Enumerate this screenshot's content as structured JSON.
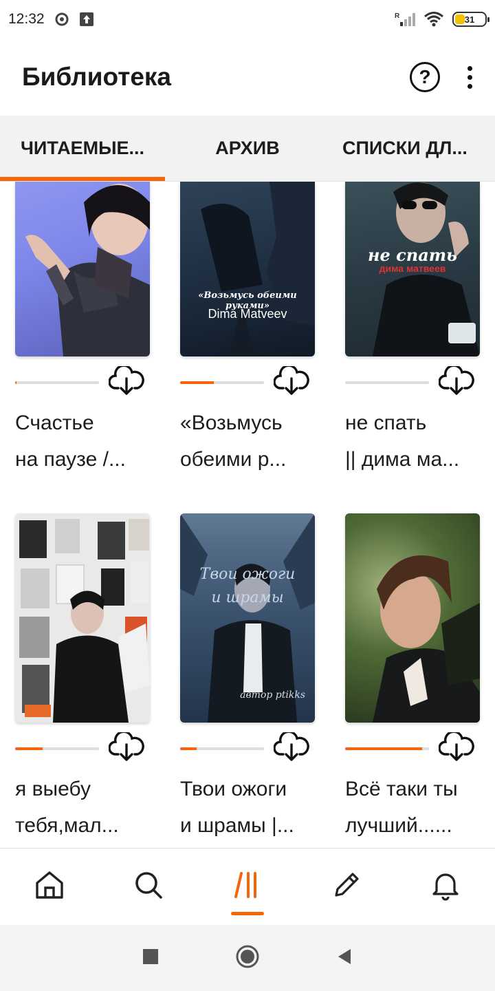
{
  "status_bar": {
    "time": "12:32",
    "battery": "31"
  },
  "app_bar": {
    "title": "Библиотека",
    "help_label": "?"
  },
  "tabs": [
    {
      "label": "ЧИТАЕМЫЕ..."
    },
    {
      "label": "АРХИВ"
    },
    {
      "label": "СПИСКИ ДЛ..."
    }
  ],
  "books": [
    {
      "title_line1": "Счастье",
      "title_line2": "на паузе /...",
      "progress": 0.02
    },
    {
      "title_line1": "«Возьмусь",
      "title_line2": "обеими р...",
      "progress": 0.4,
      "cover_text_1": "«Возьмусь обеими руками»",
      "cover_text_2": "Dima Matveev"
    },
    {
      "title_line1": "не спать",
      "title_line2": "|| дима ма...",
      "progress": 0.0,
      "cover_text_1": "не спать",
      "cover_text_2": "дима матвеев"
    },
    {
      "title_line1": "я выебу",
      "title_line2": "тебя,мал...",
      "progress": 0.33
    },
    {
      "title_line1": "Твои ожоги",
      "title_line2": "и шрамы |...",
      "progress": 0.2,
      "cover_text_1": "Твои ожоги",
      "cover_text_2": "и шрамы",
      "cover_text_3": "автор ptikks"
    },
    {
      "title_line1": "Всё таки ты",
      "title_line2": "лучший......",
      "progress": 0.92
    }
  ],
  "colors": {
    "accent": "#f5650a",
    "tab_bg": "#f3f2f3"
  },
  "bottom_nav": [
    "home-icon",
    "search-icon",
    "library-icon",
    "write-icon",
    "notifications-icon"
  ]
}
